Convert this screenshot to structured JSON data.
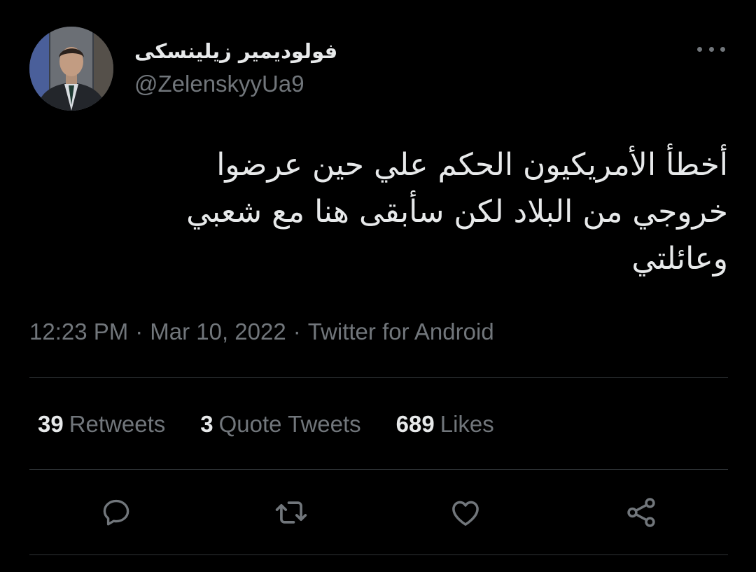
{
  "user": {
    "display_name": "فولوديمير زيلينسكى",
    "handle": "@ZelenskyyUa9",
    "avatar_icon": "profile-photo"
  },
  "tweet": {
    "text_lines": [
      "أخطأ الأمريكيون الحكم علي حين عرضوا",
      "خروجي من البلاد لكن سأبقى هنا مع شعبي",
      "وعائلتي"
    ]
  },
  "meta": {
    "time": "12:23 PM",
    "separator": "·",
    "date": "Mar 10, 2022",
    "source": "Twitter for Android"
  },
  "stats": {
    "retweets": {
      "count": "39",
      "label": "Retweets"
    },
    "quotes": {
      "count": "3",
      "label": "Quote Tweets"
    },
    "likes": {
      "count": "689",
      "label": "Likes"
    }
  },
  "actions": [
    {
      "icon": "reply-icon"
    },
    {
      "icon": "retweet-icon"
    },
    {
      "icon": "like-icon"
    },
    {
      "icon": "share-icon"
    }
  ],
  "colors": {
    "background": "#000000",
    "primary_text": "#e7e9ea",
    "secondary_text": "#71767b",
    "divider": "#2f3336"
  }
}
